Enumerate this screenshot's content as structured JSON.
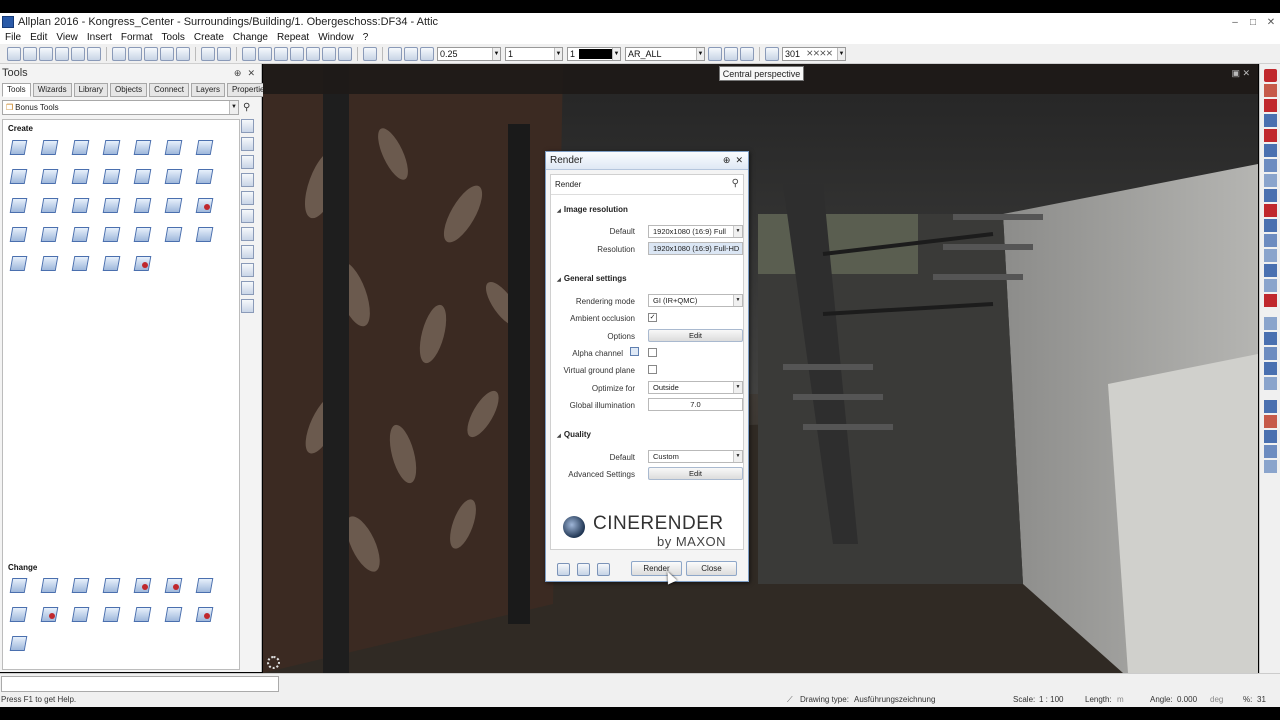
{
  "window": {
    "title": "Allplan 2016 - Kongress_Center - Surroundings/Building/1. Obergeschoss:DF34 - Attic",
    "controls": [
      "–",
      "□",
      "✕"
    ]
  },
  "menu": [
    "File",
    "Edit",
    "View",
    "Insert",
    "Format",
    "Tools",
    "Create",
    "Change",
    "Repeat",
    "Window",
    "?"
  ],
  "toolbar": {
    "pen_thickness": "0.25",
    "line_type": "1",
    "color": "1",
    "layer": "AR_ALL",
    "pattern": "301"
  },
  "tooltip": "Central perspective",
  "palette": {
    "title": "Tools",
    "pin": "⊕",
    "close": "✕",
    "tabs": [
      "Tools",
      "Wizards",
      "Library",
      "Objects",
      "Connect",
      "Layers",
      "Properties"
    ],
    "active_tab": "Tools",
    "module": "Bonus Tools",
    "sections": {
      "create": "Create",
      "change": "Change"
    }
  },
  "render_dialog": {
    "title": "Render",
    "pin": "⊕",
    "close": "✕",
    "search_text": "Render",
    "image_resolution": {
      "header": "Image resolution",
      "default_label": "Default",
      "default_value": "1920x1080 (16:9) Full",
      "resolution_label": "Resolution",
      "resolution_value": "1920x1080 (16:9) Full-HD"
    },
    "general_settings": {
      "header": "General settings",
      "rendering_mode_label": "Rendering mode",
      "rendering_mode_value": "GI (IR+QMC)",
      "ambient_occlusion_label": "Ambient occlusion",
      "ambient_occlusion_checked": true,
      "ambient_occlusion_mark": "✓",
      "options_label": "Options",
      "options_button": "Edit",
      "alpha_channel_label": "Alpha channel",
      "alpha_channel_checked": false,
      "virtual_ground_label": "Virtual ground plane",
      "virtual_ground_checked": false,
      "optimize_for_label": "Optimize for",
      "optimize_for_value": "Outside",
      "global_illumination_label": "Global illumination",
      "global_illumination_value": "7.0"
    },
    "quality": {
      "header": "Quality",
      "default_label": "Default",
      "default_value": "Custom",
      "advanced_label": "Advanced Settings",
      "advanced_button": "Edit"
    },
    "logo": {
      "brand": "CINERENDER",
      "byline": "by MAXON"
    },
    "render_button": "Render",
    "close_button": "Close"
  },
  "status": {
    "help": "Press F1 to get Help.",
    "drawing_type_label": "Drawing type:",
    "drawing_type_value": "Ausführungszeichnung",
    "scale_label": "Scale:",
    "scale_value": "1 : 100",
    "length_label": "Length:",
    "length_unit": "m",
    "angle_label": "Angle:",
    "angle_value": "0.000",
    "angle_unit": "deg",
    "percent_label": "%:",
    "percent_value": "31"
  },
  "colors": {
    "accent": "#2a5aa8",
    "dialog_border": "#7d9dc4",
    "delete_red": "#c0282d"
  }
}
